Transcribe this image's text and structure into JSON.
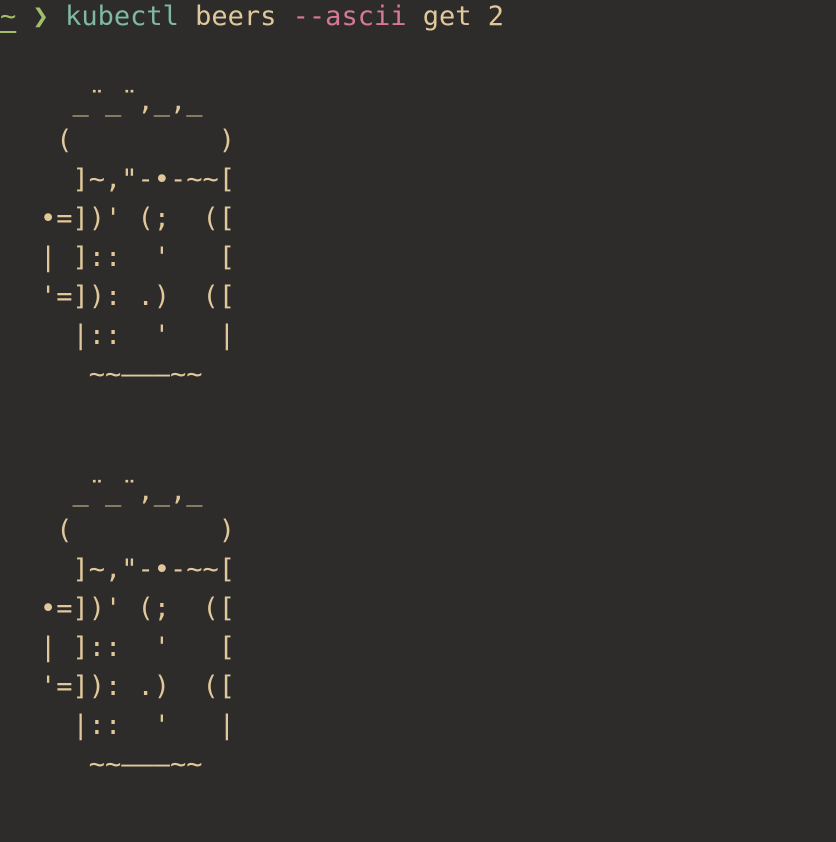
{
  "prompt": {
    "cwd": "~",
    "symbol": "❯",
    "command": "kubectl",
    "subcommand": "beers",
    "flag": "--ascii",
    "action": "get",
    "count": "2"
  },
  "output": {
    "beers": [
      {
        "art": "  _¨_¨,_,_\n (         )\n  ]~,\"-•-~~[\n•=])' (;  ([\n| ]::  '   [\n'=]): .)  ([\n  |::  '   |\n   ~~———~~"
      },
      {
        "art": "  _¨_¨,_,_\n (         )\n  ]~,\"-•-~~[\n•=])' (;  ([\n| ]::  '   [\n'=]): .)  ([\n  |::  '   |\n   ~~———~~"
      }
    ]
  },
  "colors": {
    "background": "#2d2c2b",
    "text": "#e1c89a",
    "prompt_symbol": "#a3be6a",
    "command": "#7fb8a6",
    "flag": "#d67898"
  }
}
